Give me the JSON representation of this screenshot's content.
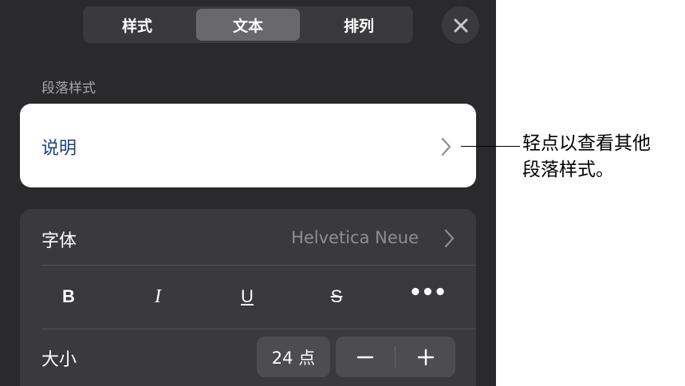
{
  "tabs": [
    {
      "label": "样式"
    },
    {
      "label": "文本",
      "selected": true
    },
    {
      "label": "排列"
    }
  ],
  "close_icon": "close-icon",
  "paragraph_style": {
    "section_label": "段落样式",
    "current": "说明"
  },
  "font": {
    "label": "字体",
    "value": "Helvetica Neue"
  },
  "format_buttons": {
    "bold": "B",
    "italic": "I",
    "underline": "U",
    "strikethrough": "S",
    "more": "•••"
  },
  "size": {
    "label": "大小",
    "value": "24 点",
    "decrease": "−",
    "increase": "+"
  },
  "callout": {
    "line1": "轻点以查看其他",
    "line2": "段落样式。"
  },
  "colors": {
    "panel_bg": "#2a2a2c",
    "card_bg": "#3a3a3d",
    "selected_segment": "#69696d",
    "style_name": "#1c3f7a"
  }
}
